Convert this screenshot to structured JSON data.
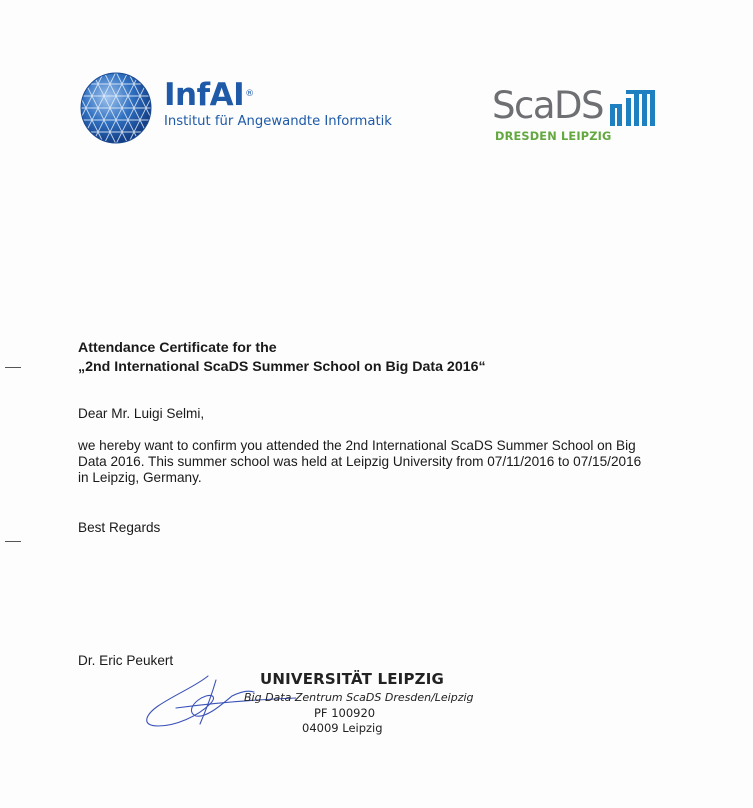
{
  "logos": {
    "infai": {
      "name": "InfAI",
      "registered_mark": "®",
      "subtitle": "Institut für Angewandte Informatik",
      "color": "#1e5aa8"
    },
    "scads": {
      "name": "ScaDS",
      "subtitle": "DRESDEN LEIPZIG",
      "name_color": "#6d6f72",
      "bars_color": "#1e7fc1",
      "subtitle_color": "#62a83f"
    }
  },
  "certificate": {
    "heading_line1": "Attendance Certificate for the",
    "heading_line2": "„2nd International ScaDS Summer School on Big Data 2016“",
    "greeting": "Dear Mr. Luigi Selmi,",
    "body_lines": [
      "we hereby want to confirm you attended the 2nd International ScaDS Summer School on Big",
      "Data 2016. This summer school was held at Leipzig University from 07/11/2016 to 07/15/2016",
      "in Leipzig, Germany."
    ],
    "closing": "Best Regards",
    "signer": "Dr. Eric Peukert"
  },
  "stamp": {
    "title": "UNIVERSITÄT LEIPZIG",
    "line1": "Big Data Zentrum ScaDS Dresden/Leipzig",
    "line2": "PF 100920",
    "line3": "04009 Leipzig"
  }
}
